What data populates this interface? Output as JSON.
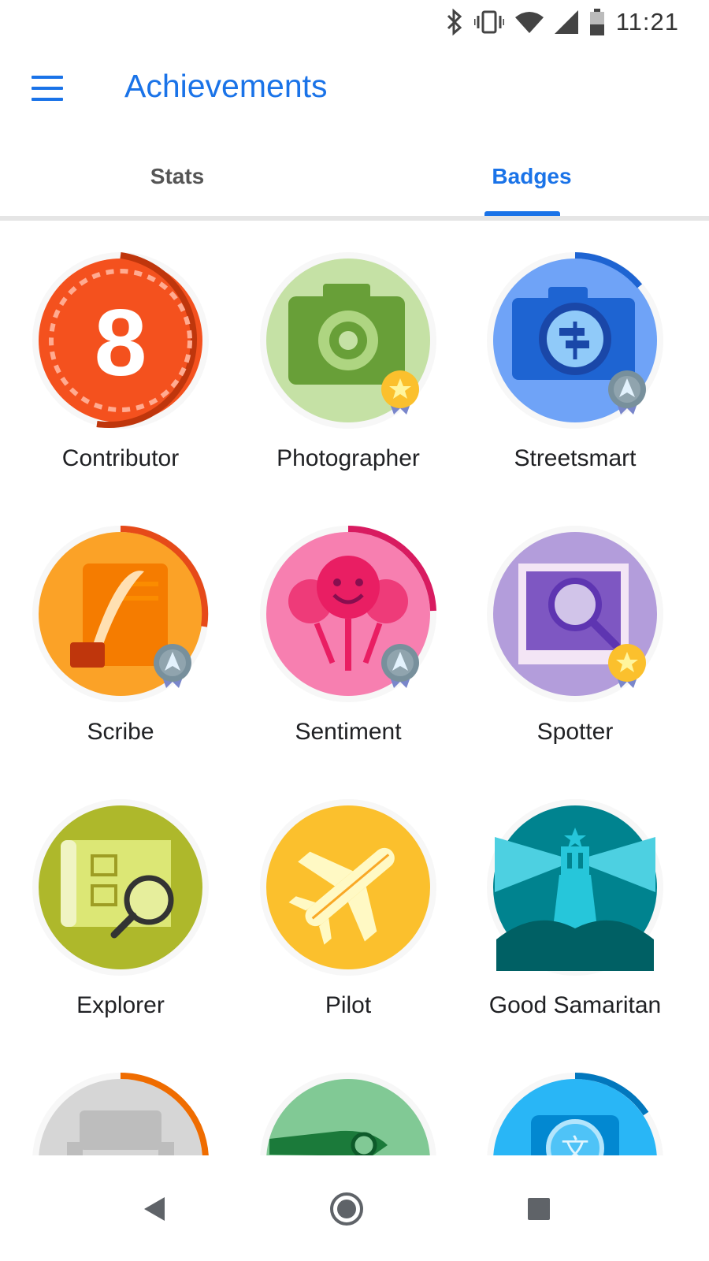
{
  "status_bar": {
    "time": "11:21",
    "icons": [
      "bluetooth-icon",
      "vibrate-icon",
      "wifi-icon",
      "signal-icon",
      "battery-icon"
    ]
  },
  "app_bar": {
    "title": "Achievements",
    "menu_icon": "menu-icon"
  },
  "tabs": [
    {
      "label": "Stats",
      "selected": false
    },
    {
      "label": "Badges",
      "selected": true
    }
  ],
  "badges": [
    {
      "label": "Contributor",
      "icon": "level-8-icon",
      "level_text": "8",
      "medal": "none",
      "progress": 0.5
    },
    {
      "label": "Photographer",
      "icon": "camera-icon",
      "medal": "gold",
      "progress": 0
    },
    {
      "label": "Streetsmart",
      "icon": "camera-signpost-icon",
      "medal": "silver",
      "progress": 0.1
    },
    {
      "label": "Scribe",
      "icon": "quill-scroll-icon",
      "medal": "silver",
      "progress": 0.3
    },
    {
      "label": "Sentiment",
      "icon": "smiley-faces-icon",
      "medal": "silver",
      "progress": 0.27
    },
    {
      "label": "Spotter",
      "icon": "photo-magnifier-icon",
      "medal": "gold",
      "progress": 0
    },
    {
      "label": "Explorer",
      "icon": "map-magnifier-icon",
      "medal": "none",
      "progress": 0
    },
    {
      "label": "Pilot",
      "icon": "airplane-icon",
      "medal": "none",
      "progress": 0
    },
    {
      "label": "Good Samaritan",
      "icon": "lighthouse-icon",
      "medal": "none",
      "progress": 0
    },
    {
      "label": "",
      "icon": "grey-badge-icon",
      "medal": "none",
      "progress": 0.22
    },
    {
      "label": "",
      "icon": "green-badge-icon",
      "medal": "none",
      "progress": 0
    },
    {
      "label": "",
      "icon": "translate-badge-icon",
      "medal": "none",
      "progress": 0.13
    }
  ],
  "colors": {
    "accent": "#1a73e8",
    "contributor": "#f4511e",
    "photographer": "#c5e1a5",
    "streetsmart": "#6fa3f7",
    "scribe": "#fba227",
    "sentiment": "#f77fb0",
    "spotter": "#b39ddb",
    "explorer": "#aeb82b",
    "pilot": "#fbc02d",
    "good_samaritan": "#00838f"
  },
  "nav_bar": {
    "back": "back-icon",
    "home": "home-icon",
    "recents": "recents-icon"
  }
}
